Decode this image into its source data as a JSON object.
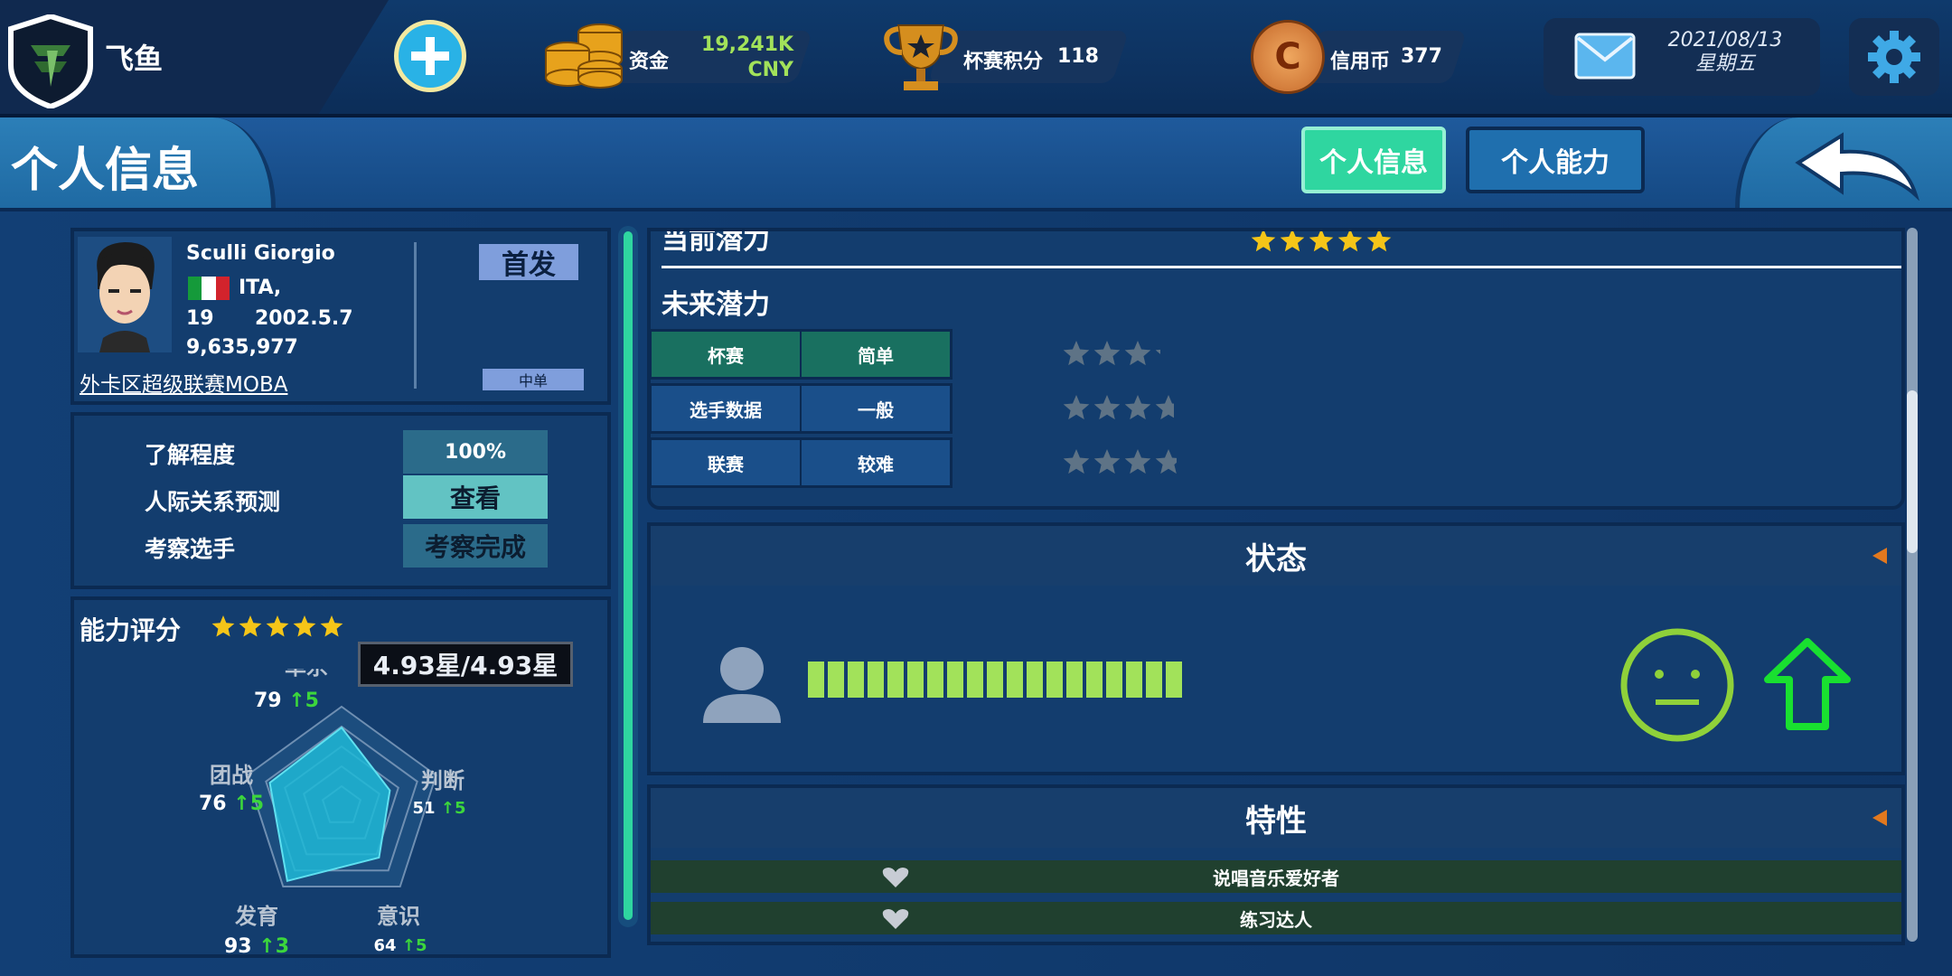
{
  "topbar": {
    "brand": "飞鱼",
    "funds_label": "资金",
    "funds_value": "19,241K",
    "funds_unit": "CNY",
    "cup_label": "杯赛积分",
    "cup_value": "118",
    "credit_label": "信用币",
    "credit_value": "377",
    "credit_symbol": "C",
    "date": "2021/08/13",
    "weekday": "星期五"
  },
  "header": {
    "title": "个人信息",
    "tab_info": "个人信息",
    "tab_ability": "个人能力"
  },
  "player": {
    "name": "Sculli Giorgio",
    "nation": "ITA,",
    "age": "19",
    "birth": "2002.5.7",
    "value": "9,635,977",
    "league": "外卡区超级联赛MOBA",
    "role_badge": "首发",
    "position": "中单"
  },
  "scout": {
    "row1_label": "了解程度",
    "row1_value": "100%",
    "row2_label": "人际关系预测",
    "row2_value": "查看",
    "row3_label": "考察选手",
    "row3_value": "考察完成"
  },
  "ability": {
    "title": "能力评分",
    "stars": 5,
    "tooltip": "4.93星/4.93星",
    "stats": [
      {
        "name": "单杀",
        "value": "79",
        "delta": "5",
        "level": 0.79
      },
      {
        "name": "判断",
        "value": "51",
        "delta": "5",
        "level": 0.51
      },
      {
        "name": "意识",
        "value": "64",
        "delta": "5",
        "level": 0.64
      },
      {
        "name": "发育",
        "value": "93",
        "delta": "3",
        "level": 0.93
      },
      {
        "name": "团战",
        "value": "76",
        "delta": "5",
        "level": 0.76
      }
    ]
  },
  "potential": {
    "current_label": "当前潜力",
    "current_stars": 5,
    "future_label": "未来潜力",
    "rows": [
      {
        "category": "杯赛",
        "difficulty": "简单",
        "stars": 3.2
      },
      {
        "category": "选手数据",
        "difficulty": "一般",
        "stars": 3.7
      },
      {
        "category": "联赛",
        "difficulty": "较难",
        "stars": 3.8
      }
    ]
  },
  "status": {
    "title": "状态",
    "bar_segments": 19
  },
  "traits": {
    "title": "特性",
    "items": [
      "说唱音乐爱好者",
      "练习达人"
    ]
  },
  "colors": {
    "accent_green": "#2fd6a0",
    "star": "#f5c518",
    "status_bar": "#a2e25a",
    "arrow_up": "#19e030",
    "face": "#8fd13a"
  },
  "icons": {
    "logo": "shield-logo-icon",
    "add": "plus-icon",
    "coins": "coins-icon",
    "trophy": "trophy-icon",
    "credit": "credit-coin-icon",
    "mail": "mail-icon",
    "settings": "gear-icon",
    "back": "back-arrow-icon"
  }
}
